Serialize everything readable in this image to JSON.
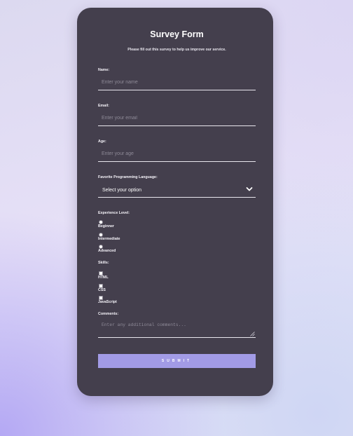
{
  "form": {
    "title": "Survey Form",
    "subtitle": "Please fill out this survey to help us improve our service.",
    "name": {
      "label": "Name:",
      "placeholder": "Enter your name"
    },
    "email": {
      "label": "Email:",
      "placeholder": "Enter your email"
    },
    "age": {
      "label": "Age:",
      "placeholder": "Enter your age"
    },
    "language": {
      "label": "Favorite Programming Language:",
      "selected": "Select your option"
    },
    "experience": {
      "label": "Experience Level:",
      "options": [
        "Beginner",
        "Intermediate",
        "Advanced"
      ]
    },
    "skills": {
      "label": "Skills:",
      "options": [
        "HTML",
        "CSS",
        "JavaScript"
      ]
    },
    "comments": {
      "label": "Comments:",
      "placeholder": "Enter any additional comments..."
    },
    "submit_label": "Submit"
  },
  "colors": {
    "card": "#443f4d",
    "accent": "#a29be6",
    "text": "#ffffff"
  },
  "icons": {
    "select": "chevron-down-icon",
    "textarea": "resize-grip-icon"
  }
}
